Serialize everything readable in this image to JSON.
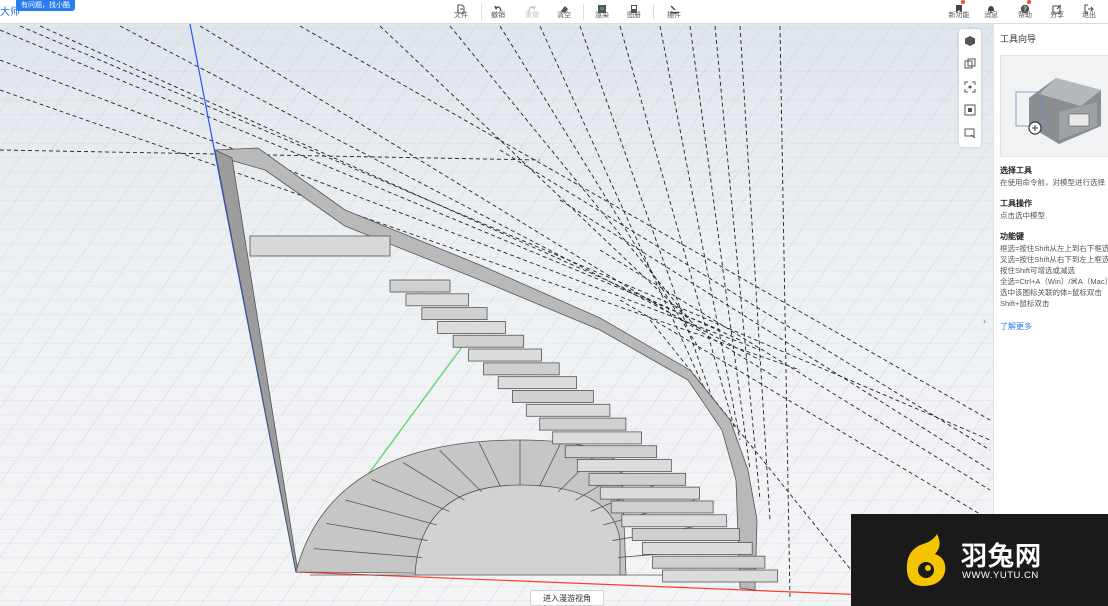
{
  "app": {
    "brand_fragment": "大师",
    "help_button": "有问题，找小酷"
  },
  "toolbar": {
    "left_tools": [
      {
        "label": "文件",
        "icon": "file-icon"
      },
      {
        "label": "撤销",
        "icon": "undo-icon"
      },
      {
        "label": "重做",
        "icon": "redo-icon"
      },
      {
        "label": "清空",
        "icon": "eraser-icon"
      },
      {
        "label": "渲染",
        "icon": "render-icon"
      },
      {
        "label": "图册",
        "icon": "album-icon"
      },
      {
        "label": "插件",
        "icon": "plugin-icon"
      }
    ],
    "right_tools": [
      {
        "label": "新功能",
        "icon": "bookmark-icon"
      },
      {
        "label": "消息",
        "icon": "bell-icon"
      },
      {
        "label": "帮助",
        "icon": "help-icon"
      },
      {
        "label": "分享",
        "icon": "share-icon"
      },
      {
        "label": "退出",
        "icon": "exit-icon"
      }
    ],
    "notification_color": "#e74c3c"
  },
  "viewport": {
    "view_tools": [
      "view-cube-icon",
      "perspective-icon",
      "fit-view-icon",
      "fullscreen-icon",
      "camera-icon"
    ],
    "walk_button": "进入漫游视角",
    "collapse_glyph": "›",
    "axis_colors": {
      "x": "#ff3b30",
      "y": "#4cd964",
      "z": "#2255ff"
    }
  },
  "panel": {
    "title": "工具向导",
    "sections": [
      {
        "heading": "选择工具",
        "lines": [
          "在使用命令前，对模型进行选择"
        ]
      },
      {
        "heading": "工具操作",
        "lines": [
          "点击选中模型"
        ]
      },
      {
        "heading": "功能键",
        "lines": [
          "框选=按住Shift从左上到右下框选",
          "叉选=按住Shift从右下到左上框选",
          "按住Shift可增选或减选",
          "全选=Ctrl+A（Win）/⌘A（Mac）",
          "选中该图标关联的体=鼠标双击",
          "Shift+鼠标双击"
        ]
      }
    ],
    "more_link": "了解更多"
  },
  "watermark": {
    "brand_cn": "羽兔网",
    "brand_url": "WWW.YUTU.CN",
    "logo_color": "#f5c400"
  }
}
